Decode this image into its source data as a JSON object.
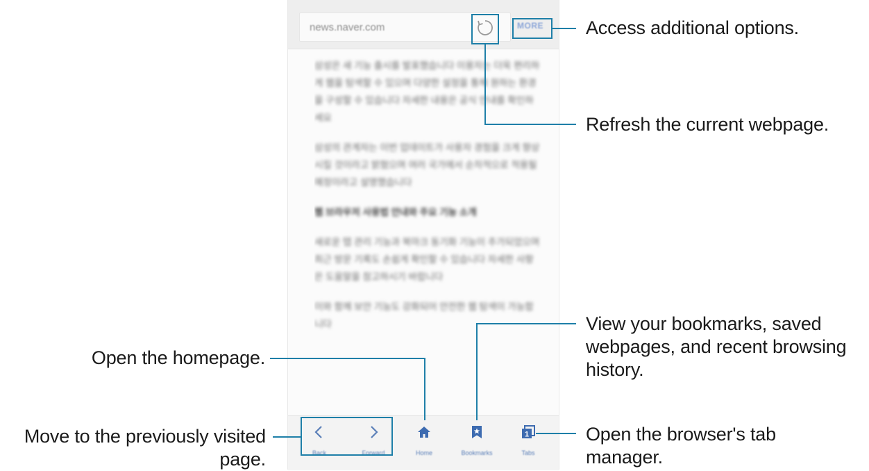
{
  "browser": {
    "url": "news.naver.com",
    "more_label": "MORE",
    "accent_color": "#1e7fa8",
    "link_color": "#5a7fb8",
    "content_paragraphs": [
      "삼성은 새 기능 출시를 발표했습니다 이용자는 더욱 편리하게 웹을 탐색할 수 있으며 다양한 설정을 통해 원하는 환경을 구성할 수 있습니다 자세한 내용은 공식 안내를 확인하세요",
      "삼성의 관계자는 이번 업데이트가 사용자 경험을 크게 향상시킬 것이라고 밝혔으며 여러 국가에서 순차적으로 적용될 예정이라고 설명했습니다",
      "웹 브라우저 사용법 안내와 주요 기능 소개",
      "새로운 탭 관리 기능과 북마크 동기화 기능이 추가되었으며 최근 방문 기록도 손쉽게 확인할 수 있습니다 자세한 사항은 도움말을 참고하시기 바랍니다",
      "이와 함께 보안 기능도 강화되어 안전한 웹 탐색이 가능합니다"
    ],
    "nav": [
      {
        "label": "Back",
        "icon": "chevron-left-icon"
      },
      {
        "label": "Forward",
        "icon": "chevron-right-icon"
      },
      {
        "label": "Home",
        "icon": "home-icon"
      },
      {
        "label": "Bookmarks",
        "icon": "bookmark-icon"
      },
      {
        "label": "Tabs",
        "icon": "tabs-icon",
        "count": "1"
      }
    ]
  },
  "annotations": {
    "more": "Access additional options.",
    "refresh": "Refresh the current webpage.",
    "bookmarks": [
      "View your bookmarks, saved",
      "webpages, and recent browsing",
      "history."
    ],
    "home": "Open the homepage.",
    "back": [
      "Move to the previously visited",
      "page."
    ],
    "tabs": [
      "Open the browser's tab",
      "manager."
    ]
  }
}
